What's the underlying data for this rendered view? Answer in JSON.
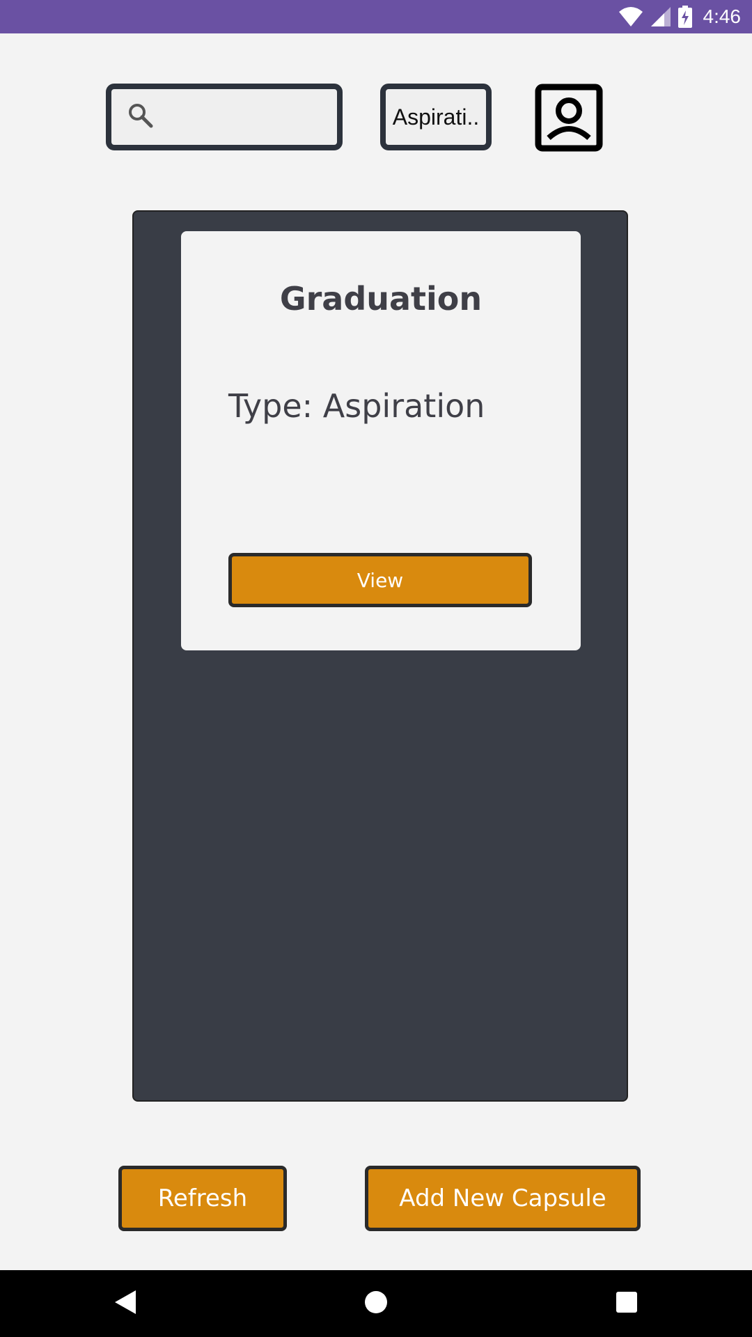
{
  "status_bar": {
    "time": "4:46",
    "color": "#6a51a3",
    "icons": [
      "wifi-icon",
      "cell-signal-icon",
      "battery-charging-icon"
    ]
  },
  "top_bar": {
    "search": {
      "placeholder": "",
      "value": "",
      "icon": "search-icon"
    },
    "filter": {
      "selected": "Aspirati.."
    },
    "profile": {
      "icon": "profile-icon"
    }
  },
  "capsules": [
    {
      "title": "Graduation",
      "type_text": "Type: Aspiration",
      "view_label": "View"
    }
  ],
  "actions": {
    "refresh_label": "Refresh",
    "add_label": "Add New Capsule"
  },
  "nav_bar": {
    "icons": [
      "back-icon",
      "home-icon",
      "recents-icon"
    ]
  },
  "colors": {
    "accent": "#d98a0e",
    "panel": "#393d46",
    "background": "#f3f3f3"
  }
}
